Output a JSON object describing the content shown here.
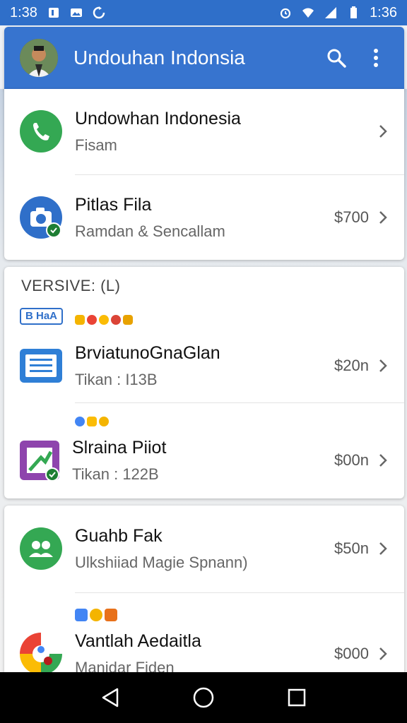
{
  "status": {
    "time_left": "1:38",
    "time_right": "1:36"
  },
  "appbar": {
    "title": "Undouhan Indonsia"
  },
  "card1": {
    "rows": [
      {
        "title": "Undowhan Indonesia",
        "subtitle": "Fisam",
        "price": ""
      },
      {
        "title": "Pitlas Fila",
        "subtitle": "Ramdan & Sencallam",
        "price": "$700"
      }
    ]
  },
  "card2": {
    "section_label": "VERSIVE: (L)",
    "chip_label": "B HaA",
    "rows": [
      {
        "title": "BrviatunoGnaGlan",
        "subtitle": "Tikan : I13B",
        "price": "$20n"
      },
      {
        "title": "Slraina Piiot",
        "subtitle": "Tikan : 122B",
        "price": "$00n"
      }
    ]
  },
  "card3": {
    "rows": [
      {
        "title": "Guahb Fak",
        "subtitle": "Ulkshiiad Magie Spnann)",
        "price": "$50n"
      },
      {
        "title": "Vantlah Aedaitla",
        "subtitle": "Manidar Fiden",
        "price": "$000"
      }
    ]
  },
  "icons": {
    "row_icons": [
      "phone-icon",
      "camera-icon",
      "document-icon",
      "image-editor-icon",
      "people-icon",
      "colorful-app-icon"
    ]
  },
  "colors": {
    "accent": "#3774cf",
    "green": "#34a853",
    "blue": "#2f6fc9",
    "purple": "#8e44ad"
  }
}
